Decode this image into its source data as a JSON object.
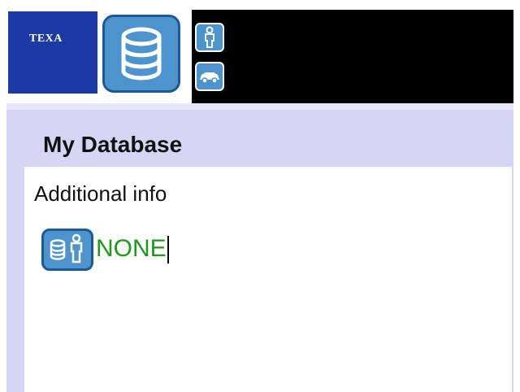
{
  "brand": {
    "logo_text": "TEXA"
  },
  "header": {
    "main_icon": "database-icon",
    "side_buttons": [
      {
        "icon": "person-icon"
      },
      {
        "icon": "car-icon"
      }
    ]
  },
  "page": {
    "title": "My Database"
  },
  "panel": {
    "section_label": "Additional info",
    "field_icon": "database-person-icon",
    "field_value": "NONE"
  },
  "colors": {
    "brand_blue": "#1b3aa6",
    "icon_blue": "#4d93cd",
    "background_lavender": "#d6d6f4",
    "value_green": "#1a9c1a"
  }
}
